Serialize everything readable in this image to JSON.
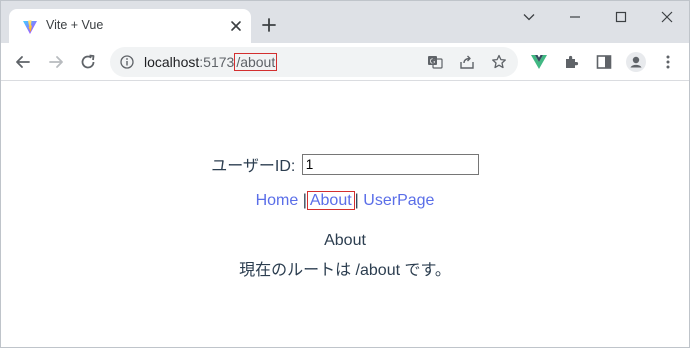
{
  "browser": {
    "tab_title": "Vite + Vue",
    "url": {
      "host": "localhost",
      "port": ":5173",
      "path": "/about"
    }
  },
  "app": {
    "user_id_label": "ユーザーID:",
    "user_id_value": "1",
    "nav": {
      "home": "Home",
      "about": "About",
      "user": "UserPage",
      "separator": "|"
    },
    "view": {
      "title": "About",
      "text": "現在のルートは /about です。"
    }
  },
  "colors": {
    "link": "#5a6ee8",
    "text": "#2c3e50",
    "highlight_box": "#d32f2f",
    "tab_strip": "#dee1e6"
  },
  "icons": {
    "favicon": "vite-icon",
    "tab_close": "close-icon",
    "new_tab": "plus-icon",
    "back": "arrow-left-icon",
    "forward": "arrow-right-icon",
    "reload": "reload-icon",
    "site_info": "info-icon",
    "translate": "translate-icon",
    "share": "share-icon",
    "bookmark": "star-icon",
    "vue_devtools": "vue-icon",
    "extensions": "puzzle-icon",
    "side_panel": "side-panel-icon",
    "profile": "avatar-icon",
    "menu": "kebab-menu-icon"
  }
}
